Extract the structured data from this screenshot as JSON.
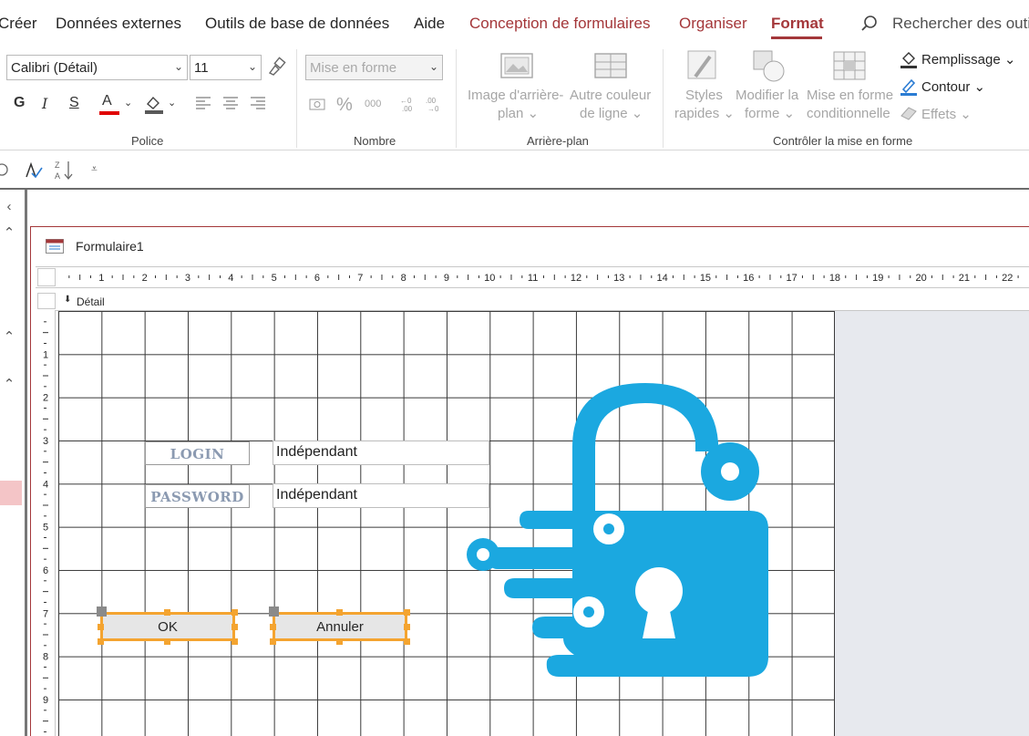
{
  "tabs": {
    "items": [
      "Créer",
      "Données externes",
      "Outils de base de données",
      "Aide"
    ],
    "contextual": [
      "Conception de formulaires",
      "Organiser"
    ],
    "active": "Format",
    "search_placeholder": "Rechercher des outi"
  },
  "ribbon": {
    "police": {
      "label": "Police",
      "font_name": "Calibri (Détail)",
      "font_size": "11",
      "bold": "G",
      "italic": "I",
      "underline": "S",
      "font_color_letter": "A"
    },
    "nombre": {
      "label": "Nombre",
      "format_placeholder": "Mise en forme",
      "percent": "%",
      "thousands": "000"
    },
    "arriere_plan": {
      "label": "Arrière-plan",
      "image_label_1": "Image d'arrière-",
      "image_label_2": "plan",
      "color_label_1": "Autre couleur",
      "color_label_2": "de ligne"
    },
    "controle": {
      "label": "Contrôler la mise en forme",
      "styles_1": "Styles",
      "styles_2": "rapides",
      "shape_1": "Modifier la",
      "shape_2": "forme",
      "cond_1": "Mise en forme",
      "cond_2": "conditionnelle",
      "fill": "Remplissage",
      "outline": "Contour",
      "effects": "Effets"
    }
  },
  "document": {
    "title": "Formulaire1",
    "section": "Détail",
    "ruler_top": [
      "1",
      "2",
      "3",
      "4",
      "5",
      "6",
      "7",
      "8",
      "9",
      "10",
      "11",
      "12",
      "13",
      "14",
      "15",
      "16",
      "17",
      "18",
      "19",
      "20",
      "21",
      "22"
    ],
    "ruler_left": [
      "1",
      "2",
      "3",
      "4",
      "5",
      "6",
      "7",
      "8",
      "9"
    ]
  },
  "form": {
    "login_label": "LOGIN",
    "password_label": "PASSWORD",
    "login_value": "Indépendant",
    "password_value": "Indépendant",
    "ok_button": "OK",
    "cancel_button": "Annuler"
  },
  "colors": {
    "accent": "#a4373a",
    "lock": "#1ba8e0",
    "selection": "#f4a430"
  },
  "icons": [
    "search-icon",
    "format-painter-icon",
    "form-icon",
    "lock-image"
  ]
}
